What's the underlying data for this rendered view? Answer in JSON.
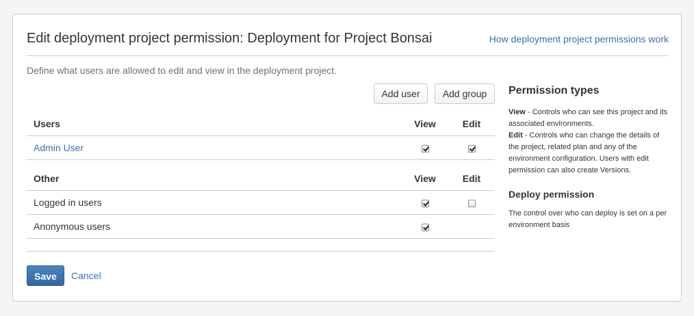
{
  "header": {
    "title": "Edit deployment project permission: Deployment for Project Bonsai",
    "help_link": "How deployment project permissions work"
  },
  "description": "Define what users are allowed to edit and view in the deployment project.",
  "toolbar": {
    "add_user_label": "Add user",
    "add_group_label": "Add group"
  },
  "users_section": {
    "heading": "Users",
    "view_label": "View",
    "edit_label": "Edit",
    "rows": [
      {
        "name": "Admin User",
        "view": true,
        "edit": true
      }
    ]
  },
  "other_section": {
    "heading": "Other",
    "view_label": "View",
    "edit_label": "Edit",
    "rows": [
      {
        "name": "Logged in users",
        "view": true,
        "edit": false
      },
      {
        "name": "Anonymous users",
        "view": true,
        "edit": null
      }
    ]
  },
  "form": {
    "save_label": "Save",
    "cancel_label": "Cancel"
  },
  "sidebar": {
    "permission_types_title": "Permission types",
    "view_term": "View",
    "view_desc": " - Controls who can see this project and its associated environments.",
    "edit_term": "Edit",
    "edit_desc": " - Controls who can change the details of the project, related plan and any of the environment configuration. Users with edit permission can also create Versions.",
    "deploy_title": "Deploy permission",
    "deploy_desc": "The control over who can deploy is set on a per environment basis"
  },
  "colors": {
    "link": "#3572b0",
    "primary_button": "#3266a3",
    "border": "#cccccc",
    "background": "#f5f5f5"
  }
}
